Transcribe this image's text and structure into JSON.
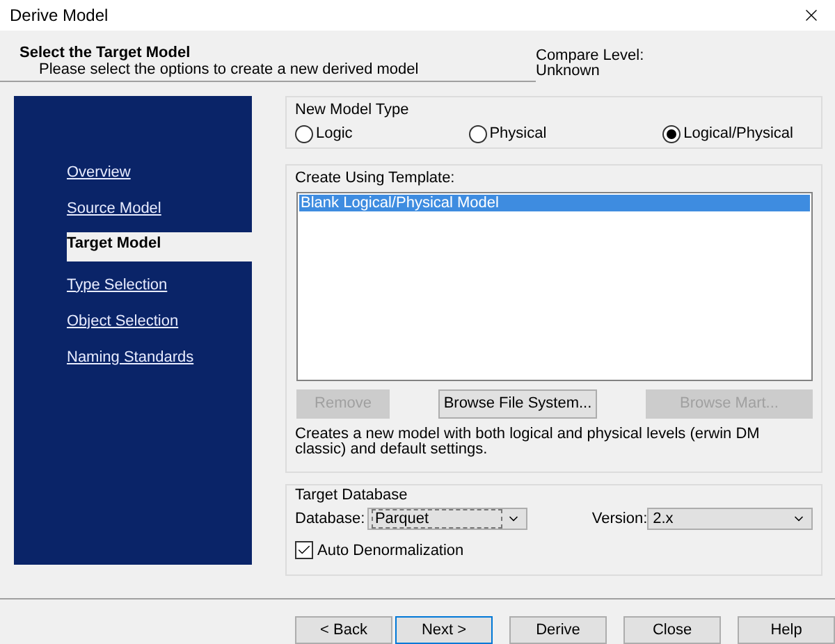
{
  "window": {
    "title": "Derive Model"
  },
  "header": {
    "title": "Select the Target Model",
    "subtitle": "Please select the options to create a new derived model",
    "compare_label": "Compare Level:",
    "compare_value": "Unknown"
  },
  "sidebar": {
    "items": [
      {
        "label": "Overview",
        "selected": false
      },
      {
        "label": "Source Model",
        "selected": false
      },
      {
        "label": "Target Model",
        "selected": true
      },
      {
        "label": "Type Selection",
        "selected": false
      },
      {
        "label": "Object Selection",
        "selected": false
      },
      {
        "label": "Naming Standards",
        "selected": false
      }
    ]
  },
  "model_type": {
    "title": "New Model Type",
    "options": [
      {
        "label": "Logic",
        "selected": false
      },
      {
        "label": "Physical",
        "selected": false
      },
      {
        "label": "Logical/Physical",
        "selected": true
      }
    ]
  },
  "template": {
    "title": "Create Using Template:",
    "items": [
      {
        "label": "Blank Logical/Physical Model",
        "selected": true
      }
    ],
    "buttons": [
      {
        "label": "Remove",
        "disabled": true
      },
      {
        "label": "Browse File System...",
        "disabled": false
      },
      {
        "label": "Browse Mart...",
        "disabled": true
      }
    ],
    "description": "Creates a new model with both logical and physical levels (erwin DM classic) and default settings."
  },
  "target_database": {
    "title": "Target Database",
    "database_label": "Database:",
    "database_value": "Parquet",
    "version_label": "Version:",
    "version_value": "2.x",
    "auto_denormalization": {
      "label": "Auto Denormalization",
      "checked": true
    }
  },
  "footer_buttons": [
    {
      "label": "< Back",
      "selected": false
    },
    {
      "label": "Next >",
      "selected": true
    },
    {
      "label": "Derive",
      "selected": false
    },
    {
      "label": "Close",
      "selected": false
    },
    {
      "label": "Help",
      "selected": false
    }
  ]
}
